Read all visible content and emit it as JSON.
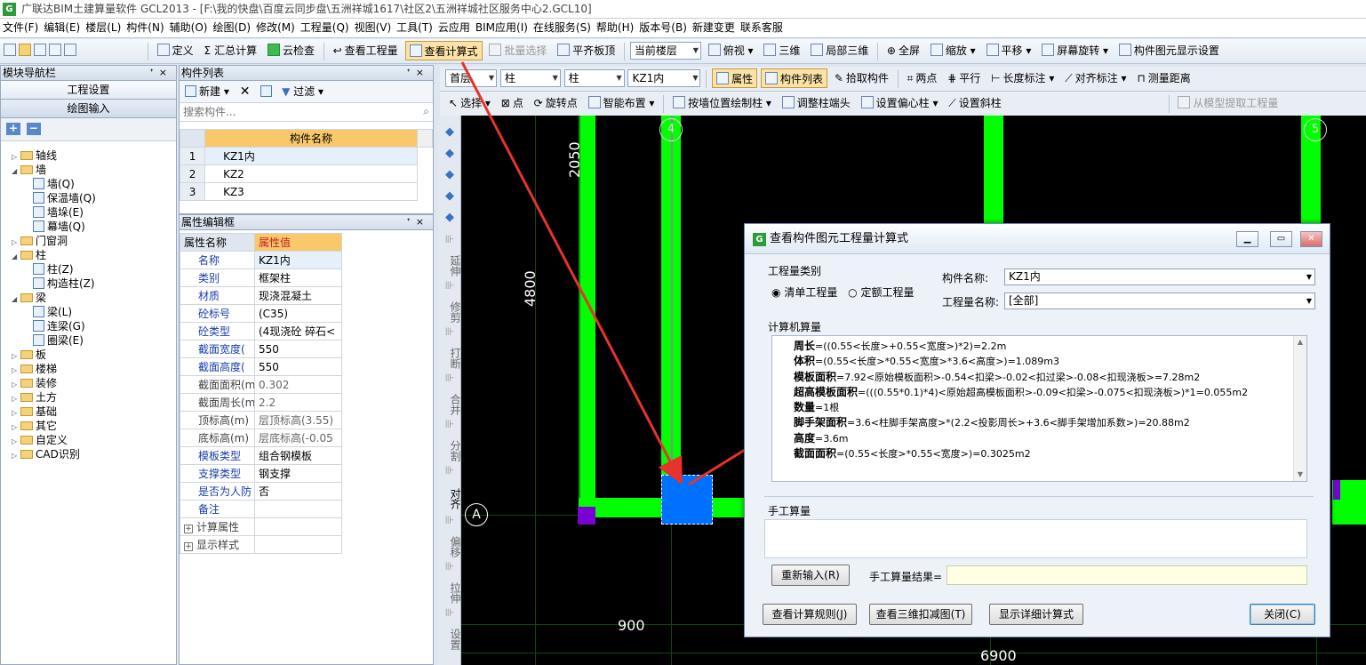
{
  "window": {
    "title": "广联达BIM土建算量软件 GCL2013 - [F:\\我的快盘\\百度云同步盘\\五洲祥城1617\\社区2\\五洲祥城社区服务中心2.GCL10]"
  },
  "menu": [
    "文件(F)",
    "编辑(E)",
    "楼层(L)",
    "构件(N)",
    "辅助(O)",
    "绘图(D)",
    "修改(M)",
    "工程量(Q)",
    "视图(V)",
    "工具(T)",
    "云应用",
    "BIM应用(I)",
    "在线服务(S)",
    "帮助(H)",
    "版本号(B)",
    "新建变更",
    "联系客服"
  ],
  "toolbar1": {
    "define": "定义",
    "sum": "汇总计算",
    "cloud_check": "云检查",
    "view_qty": "查看工程量",
    "view_formula": "查看计算式",
    "batch_select": "批量选择",
    "flush_slab": "平齐板顶",
    "floor_combo": "当前楼层",
    "top_view": "俯视",
    "three_d": "三维",
    "partial_3d": "局部三维",
    "fullscreen": "全屏",
    "zoom": "缩放",
    "pan": "平移",
    "rotate": "屏幕旋转",
    "display_settings": "构件图元显示设置"
  },
  "toolbar2": {
    "floor": "首层",
    "category": "柱",
    "type": "柱",
    "component": "KZ1内",
    "props": "属性",
    "comp_list": "构件列表",
    "pick": "拾取构件",
    "two_points": "两点",
    "parallel": "平行",
    "length_dim": "长度标注",
    "align_dim": "对齐标注",
    "measure": "测量距离"
  },
  "toolbar3": {
    "select": "选择",
    "point": "点",
    "rotate_point": "旋转点",
    "smart_layout": "智能布置",
    "by_wall": "按墙位置绘制柱",
    "adjust_end": "调整柱端头",
    "set_offset": "设置偏心柱",
    "set_slope": "设置斜柱",
    "extract": "从模型提取工程量"
  },
  "nav": {
    "title": "模块导航栏",
    "project_settings": "工程设置",
    "drawing_input": "绘图输入",
    "tree": [
      {
        "label": "轴线",
        "level": 0,
        "open": false
      },
      {
        "label": "墙",
        "level": 0,
        "open": true
      },
      {
        "label": "墙(Q)",
        "level": 1
      },
      {
        "label": "保温墙(Q)",
        "level": 1
      },
      {
        "label": "墙垛(E)",
        "level": 1
      },
      {
        "label": "幕墙(Q)",
        "level": 1
      },
      {
        "label": "门窗洞",
        "level": 0,
        "open": false
      },
      {
        "label": "柱",
        "level": 0,
        "open": true
      },
      {
        "label": "柱(Z)",
        "level": 1
      },
      {
        "label": "构造柱(Z)",
        "level": 1
      },
      {
        "label": "梁",
        "level": 0,
        "open": true
      },
      {
        "label": "梁(L)",
        "level": 1
      },
      {
        "label": "连梁(G)",
        "level": 1
      },
      {
        "label": "圈梁(E)",
        "level": 1
      },
      {
        "label": "板",
        "level": 0,
        "open": false
      },
      {
        "label": "楼梯",
        "level": 0,
        "open": false
      },
      {
        "label": "装修",
        "level": 0,
        "open": false
      },
      {
        "label": "土方",
        "level": 0,
        "open": false
      },
      {
        "label": "基础",
        "level": 0,
        "open": false
      },
      {
        "label": "其它",
        "level": 0,
        "open": false
      },
      {
        "label": "自定义",
        "level": 0,
        "open": false
      },
      {
        "label": "CAD识别",
        "level": 0,
        "open": false
      }
    ]
  },
  "comp_list": {
    "title": "构件列表",
    "new": "新建",
    "filter": "过滤",
    "search_placeholder": "搜索构件...",
    "col_header": "构件名称",
    "rows": [
      {
        "n": "1",
        "name": "KZ1内"
      },
      {
        "n": "2",
        "name": "KZ2"
      },
      {
        "n": "3",
        "name": "KZ3"
      }
    ]
  },
  "prop_editor": {
    "title": "属性编辑框",
    "col_name": "属性名称",
    "col_value": "属性值",
    "rows": [
      {
        "k": "名称",
        "v": "KZ1内",
        "link": true
      },
      {
        "k": "类别",
        "v": "框架柱",
        "link": true
      },
      {
        "k": "材质",
        "v": "现浇混凝土",
        "link": true
      },
      {
        "k": "砼标号",
        "v": "(C35)",
        "link": true
      },
      {
        "k": "砼类型",
        "v": "(4现浇砼 碎石<",
        "link": true
      },
      {
        "k": "截面宽度(",
        "v": "550",
        "link": true
      },
      {
        "k": "截面高度(",
        "v": "550",
        "link": true
      },
      {
        "k": "截面面积(m",
        "v": "0.302",
        "link": false
      },
      {
        "k": "截面周长(m",
        "v": "2.2",
        "link": false
      },
      {
        "k": "顶标高(m)",
        "v": "层顶标高(3.55)",
        "link": false
      },
      {
        "k": "底标高(m)",
        "v": "层底标高(-0.05",
        "link": false
      },
      {
        "k": "模板类型",
        "v": "组合钢模板",
        "link": true
      },
      {
        "k": "支撑类型",
        "v": "钢支撑",
        "link": true
      },
      {
        "k": "是否为人防",
        "v": "否",
        "link": true
      },
      {
        "k": "备注",
        "v": "",
        "link": true
      },
      {
        "k": "计算属性",
        "v": "",
        "link": false,
        "expand": true
      },
      {
        "k": "显示样式",
        "v": "",
        "link": false,
        "expand": true
      }
    ]
  },
  "vertical_tools": [
    "延伸",
    "修剪",
    "打断",
    "合并",
    "分割",
    "对齐",
    "偏移",
    "拉伸",
    "设置"
  ],
  "canvas": {
    "dim_2050": "2050",
    "dim_4800": "4800",
    "dim_900": "900",
    "dim_6900": "6900",
    "axis_A": "A",
    "axis_4": "4",
    "axis_5": "5"
  },
  "dialog": {
    "title": "查看构件图元工程量计算式",
    "qty_type_label": "工程量类别",
    "opt_bill": "清单工程量",
    "opt_quota": "定额工程量",
    "comp_name_label": "构件名称:",
    "comp_name_value": "KZ1内",
    "qty_name_label": "工程量名称:",
    "qty_name_value": "[全部]",
    "computer_label": "计算机算量",
    "formulas": [
      {
        "name": "周长",
        "expr": "=((0.55<长度>+0.55<宽度>)*2)=2.2m"
      },
      {
        "name": "体积",
        "expr": "=(0.55<长度>*0.55<宽度>*3.6<高度>)=1.089m3"
      },
      {
        "name": "模板面积",
        "expr": "=7.92<原始模板面积>-0.54<扣梁>-0.02<扣过梁>-0.08<扣现浇板>=7.28m2"
      },
      {
        "name": "超高模板面积",
        "expr": "=(((0.55*0.1)*4)<原始超高模板面积>-0.09<扣梁>-0.075<扣现浇板>)*1=0.055m2"
      },
      {
        "name": "数量",
        "expr": "=1根"
      },
      {
        "name": "脚手架面积",
        "expr": "=3.6<柱脚手架高度>*(2.2<投影周长>+3.6<脚手架增加系数>)=20.88m2"
      },
      {
        "name": "高度",
        "expr": "=3.6m"
      },
      {
        "name": "截面面积",
        "expr": "=(0.55<长度>*0.55<宽度>)=0.3025m2"
      }
    ],
    "manual_label": "手工算量",
    "reenter": "重新输入(R)",
    "manual_result": "手工算量结果=",
    "btn_rules": "查看计算规则(J)",
    "btn_3d": "查看三维扣减图(T)",
    "btn_detail": "显示详细计算式",
    "btn_close": "关闭(C)"
  },
  "colors": {
    "green": "#00ff00",
    "blue": "#0066ff",
    "purple": "#7a00d4",
    "arrow": "#e8322c",
    "grid": "#0b4a0b"
  }
}
